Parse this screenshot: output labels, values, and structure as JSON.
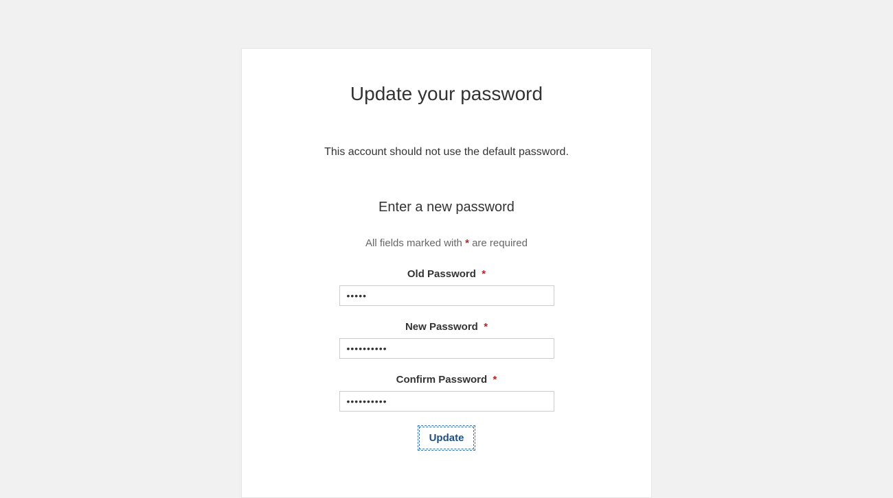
{
  "header": {
    "title": "Update your password"
  },
  "notice": "This account should not use the default password.",
  "form": {
    "section_title": "Enter a new password",
    "required_note_prefix": "All fields marked with ",
    "required_note_asterisk": "*",
    "required_note_suffix": " are required",
    "fields": {
      "old_password": {
        "label": "Old Password",
        "required_mark": "*",
        "value": "•••••"
      },
      "new_password": {
        "label": "New Password",
        "required_mark": "*",
        "value": "••••••••••"
      },
      "confirm_password": {
        "label": "Confirm Password",
        "required_mark": "*",
        "value": "••••••••••"
      }
    },
    "submit_label": "Update"
  }
}
